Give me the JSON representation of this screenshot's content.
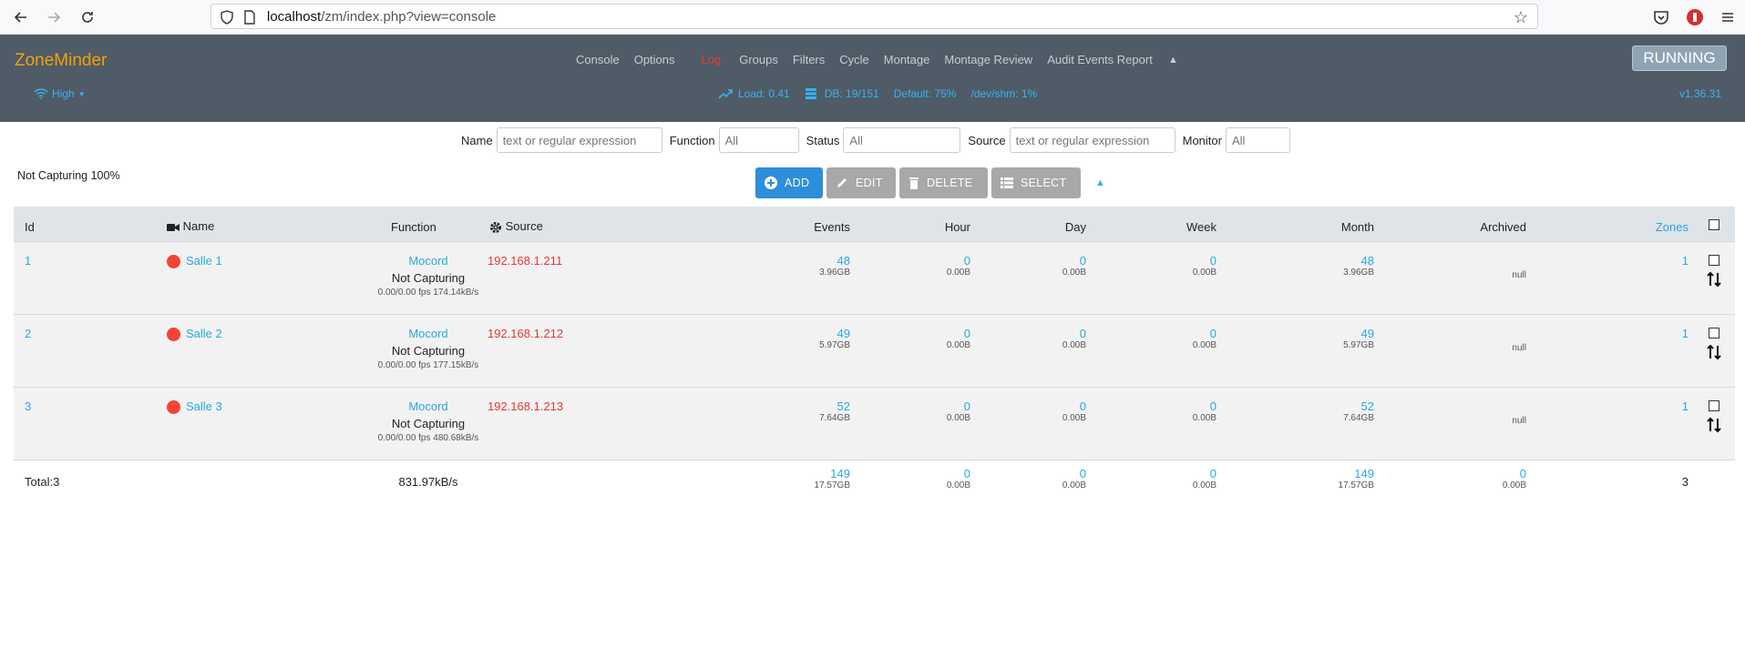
{
  "browser": {
    "url_host": "localhost",
    "url_path": "/zm/index.php?view=console"
  },
  "header": {
    "brand": "ZoneMinder",
    "menu": [
      "Console",
      "Options",
      "Log",
      "Groups",
      "Filters",
      "Cycle",
      "Montage",
      "Montage Review",
      "Audit Events Report"
    ],
    "running": "RUNNING",
    "bandwidth": "High",
    "load": "Load: 0.41",
    "db": "DB: 19/151",
    "default": "Default: 75%",
    "shm": "/dev/shm: 1%",
    "version": "v1.36.31"
  },
  "filters": {
    "name_label": "Name",
    "name_placeholder": "text or regular expression",
    "function_label": "Function",
    "function_value": "All",
    "status_label": "Status",
    "status_value": "All",
    "source_label": "Source",
    "source_placeholder": "text or regular expression",
    "monitor_label": "Monitor",
    "monitor_value": "All"
  },
  "summary": "Not Capturing 100%",
  "actions": {
    "add": "ADD",
    "edit": "EDIT",
    "delete": "DELETE",
    "select": "SELECT"
  },
  "table": {
    "headers": {
      "id": "Id",
      "name": "Name",
      "function": "Function",
      "source": "Source",
      "events": "Events",
      "hour": "Hour",
      "day": "Day",
      "week": "Week",
      "month": "Month",
      "archived": "Archived",
      "zones": "Zones"
    },
    "rows": [
      {
        "id": "1",
        "name": "Salle 1",
        "function": "Mocord",
        "status": "Not Capturing",
        "fps": "0.00/0.00 fps 174.14kB/s",
        "source": "192.168.1.211",
        "events": "48",
        "events_size": "3.96GB",
        "hour": "0",
        "hour_size": "0.00B",
        "day": "0",
        "day_size": "0.00B",
        "week": "0",
        "week_size": "0.00B",
        "month": "48",
        "month_size": "3.96GB",
        "archived": "null",
        "zones": "1"
      },
      {
        "id": "2",
        "name": "Salle 2",
        "function": "Mocord",
        "status": "Not Capturing",
        "fps": "0.00/0.00 fps 177.15kB/s",
        "source": "192.168.1.212",
        "events": "49",
        "events_size": "5.97GB",
        "hour": "0",
        "hour_size": "0.00B",
        "day": "0",
        "day_size": "0.00B",
        "week": "0",
        "week_size": "0.00B",
        "month": "49",
        "month_size": "5.97GB",
        "archived": "null",
        "zones": "1"
      },
      {
        "id": "3",
        "name": "Salle 3",
        "function": "Mocord",
        "status": "Not Capturing",
        "fps": "0.00/0.00 fps 480.68kB/s",
        "source": "192.168.1.213",
        "events": "52",
        "events_size": "7.64GB",
        "hour": "0",
        "hour_size": "0.00B",
        "day": "0",
        "day_size": "0.00B",
        "week": "0",
        "week_size": "0.00B",
        "month": "52",
        "month_size": "7.64GB",
        "archived": "null",
        "zones": "1"
      }
    ],
    "footer": {
      "total": "Total:3",
      "bandwidth": "831.97kB/s",
      "events": "149",
      "events_size": "17.57GB",
      "hour": "0",
      "hour_size": "0.00B",
      "day": "0",
      "day_size": "0.00B",
      "week": "0",
      "week_size": "0.00B",
      "month": "149",
      "month_size": "17.57GB",
      "archived": "0",
      "archived_size": "0.00B",
      "zones": "3"
    }
  }
}
